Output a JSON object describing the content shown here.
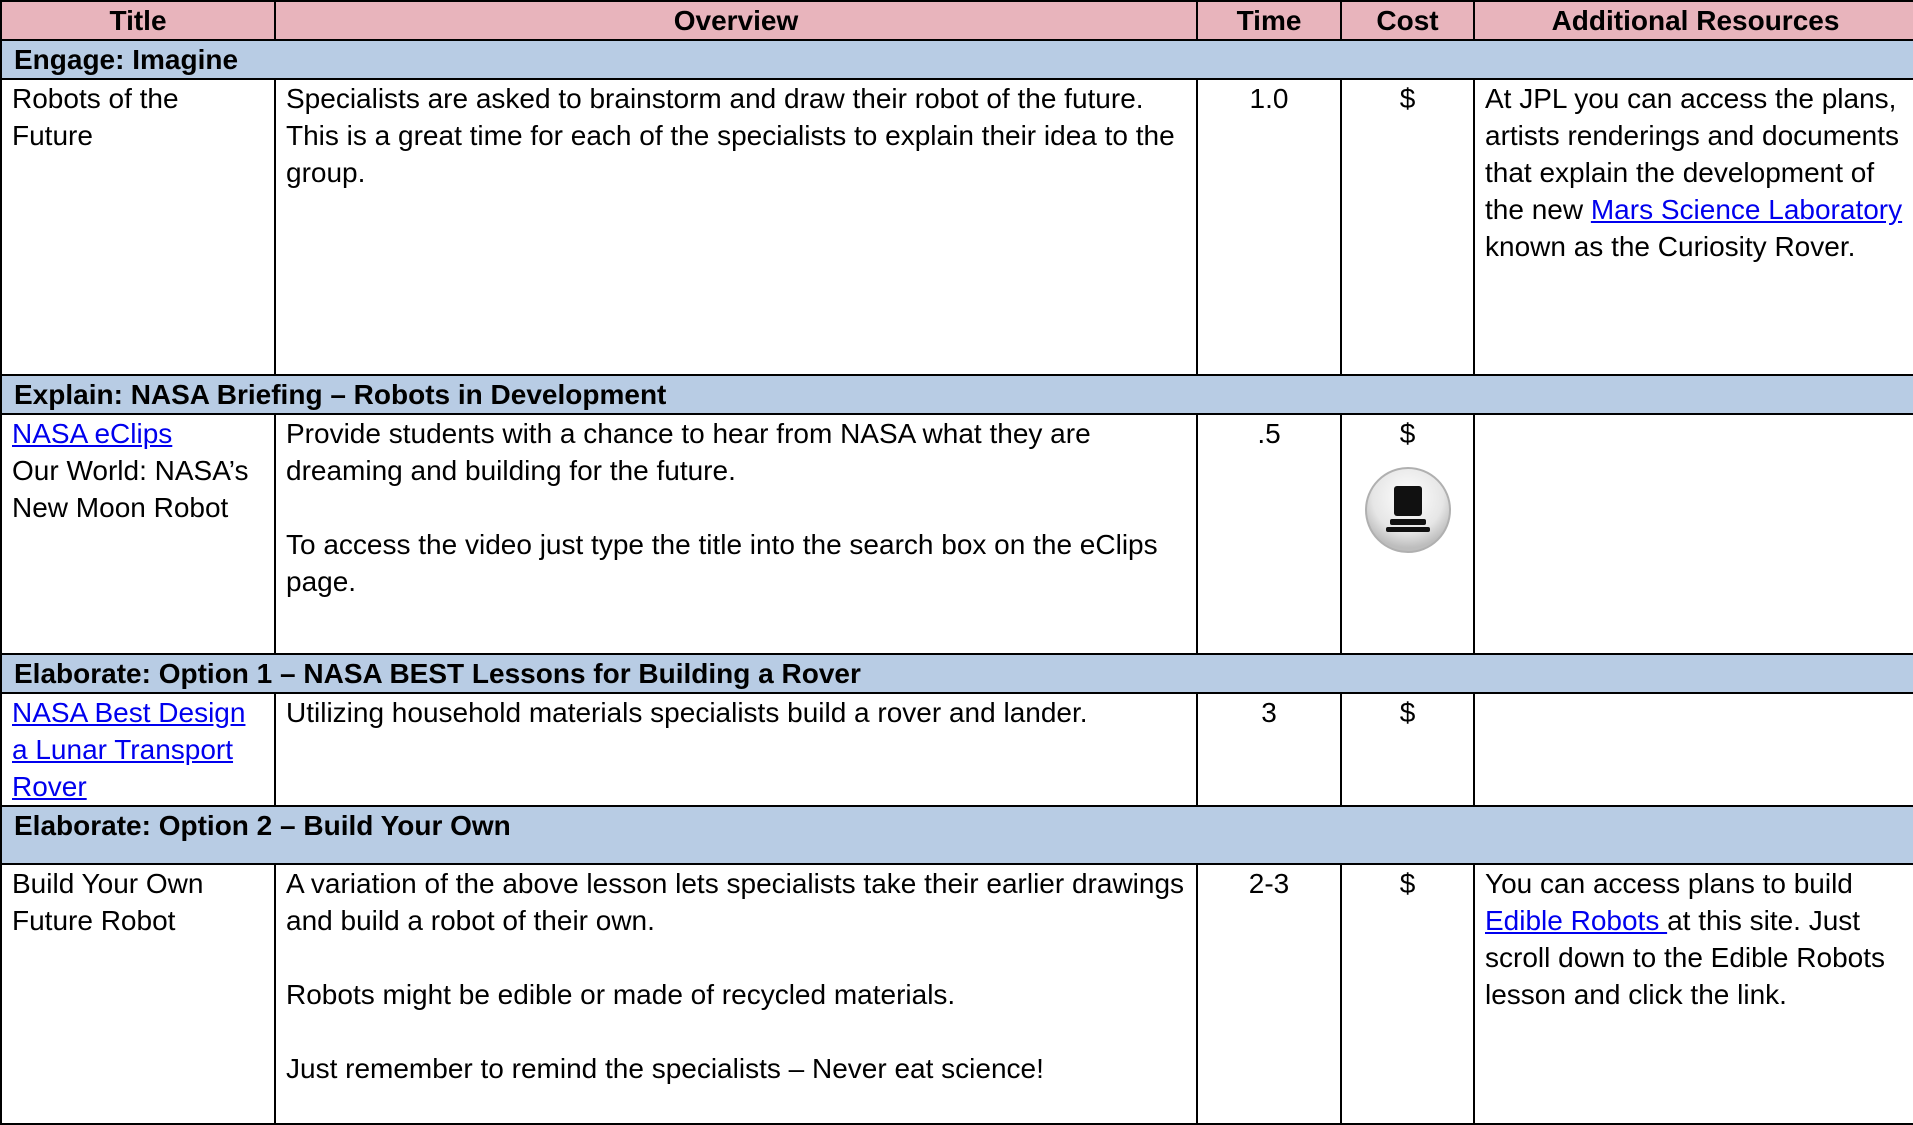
{
  "headers": [
    "Title",
    "Overview",
    "Time",
    "Cost",
    "Additional Resources"
  ],
  "sections": [
    {
      "heading": "Engage: Imagine",
      "title": "Robots of the Future",
      "overview": [
        "Specialists are asked to brainstorm and draw their robot of the future. This is a great time for each of the specialists to explain their idea to the group."
      ],
      "time": "1.0",
      "cost": "$",
      "resources_before": "At JPL you can access the plans, artists renderings and documents that explain the development of the new ",
      "resources_link": "Mars Science Laboratory ",
      "resources_after": "known as the Curiosity Rover."
    },
    {
      "heading": "Explain: NASA Briefing – Robots in Development",
      "title_link": "NASA eClips",
      "title_text": "Our World: NASA’s New Moon Robot",
      "overview": [
        "Provide students with a chance to hear from NASA what they are dreaming and building for the future.",
        "To access the video just type the title into the search box on the eClips page."
      ],
      "time": ".5",
      "cost": "$",
      "icon": "computer-icon"
    },
    {
      "heading": "Elaborate: Option 1 – NASA BEST Lessons for Building a Rover",
      "title_link": "NASA Best Design a Lunar Transport Rover",
      "overview": [
        "Utilizing household materials specialists build a rover and lander."
      ],
      "time": "3",
      "cost": "$"
    },
    {
      "heading": "Elaborate: Option 2 – Build Your Own",
      "title": "Build Your Own Future Robot",
      "overview": [
        "A variation of the above lesson lets specialists take their earlier drawings and build a robot of their own.",
        "Robots might be edible or made of recycled materials.",
        "Just remember to remind the specialists – Never eat science!"
      ],
      "time": "2-3",
      "cost": "$",
      "resources_link": "Edible Robots ",
      "resources_before": "You can access plans to build ",
      "resources_after": "at this site. Just scroll down to the Edible Robots lesson and click the link."
    }
  ]
}
